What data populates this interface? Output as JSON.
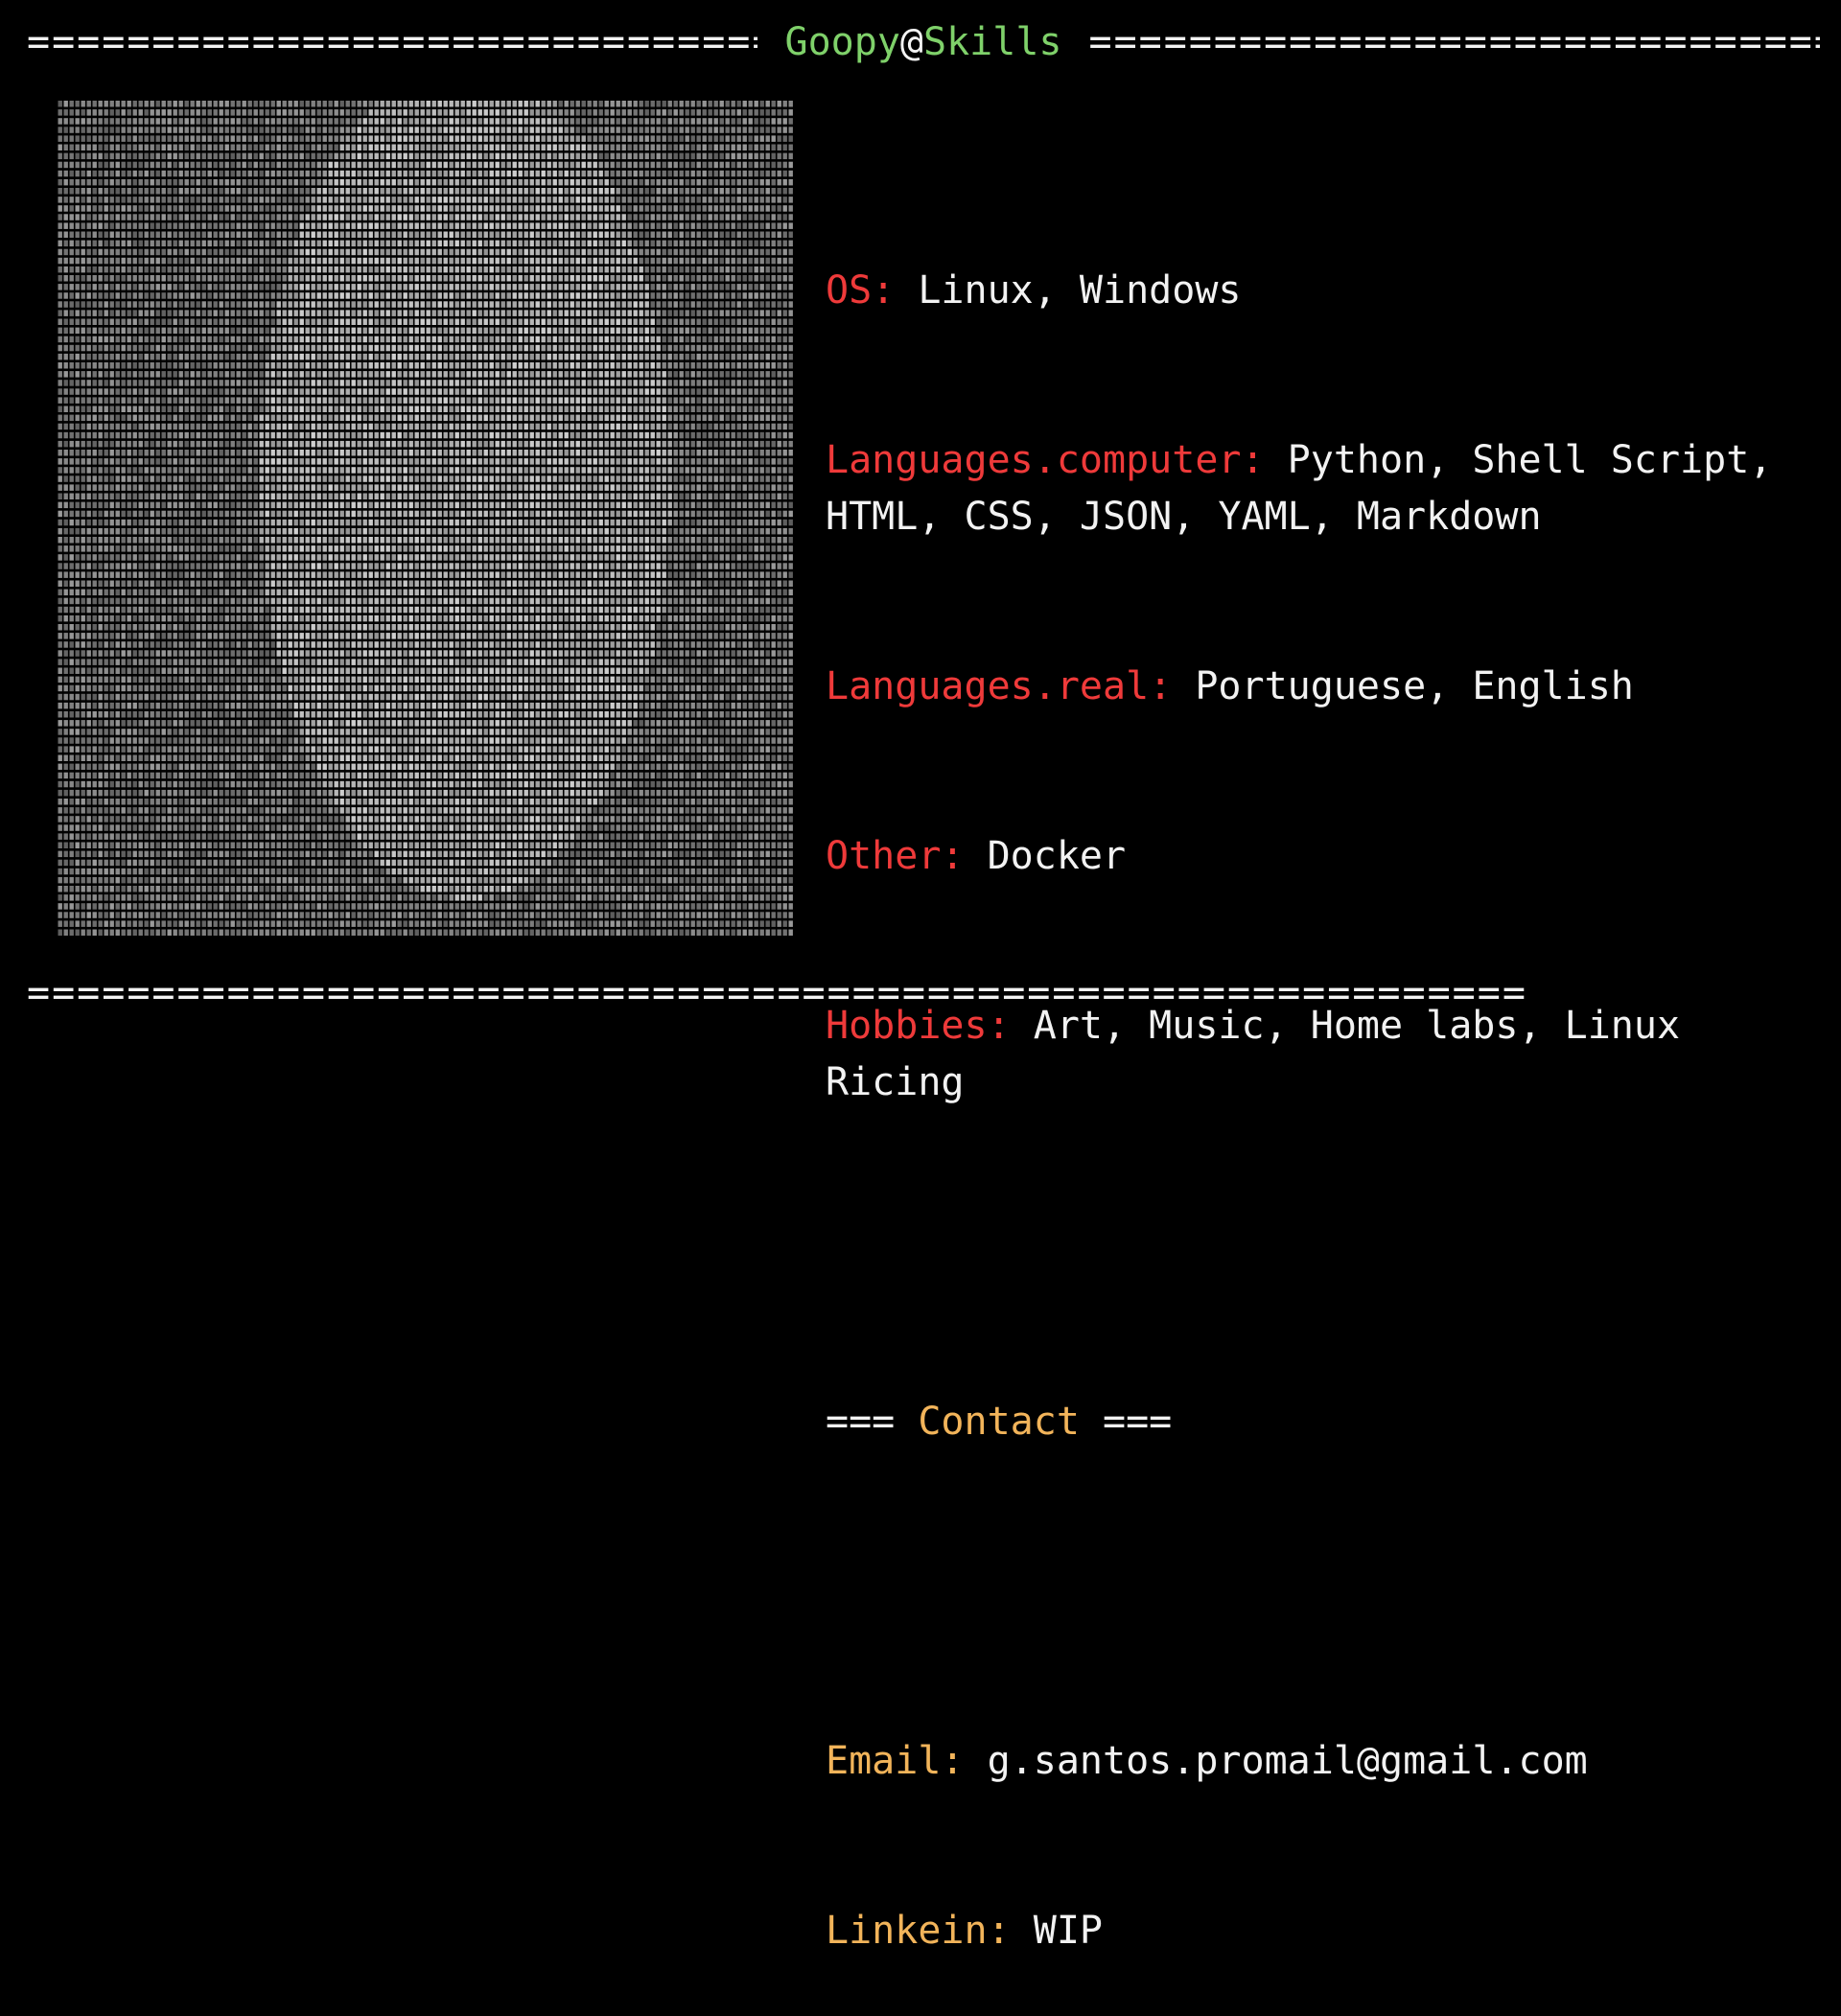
{
  "header": {
    "title_user": "Goopy",
    "title_at": "@",
    "title_host": "Skills",
    "rule_char": "="
  },
  "ascii_art": {
    "description_icon": "ascii-portrait",
    "fg_color": "#cfcfcf",
    "bg_color": "#000000"
  },
  "skills": [
    {
      "key": "OS:",
      "value": "Linux, Windows"
    },
    {
      "key": "Languages.computer:",
      "value": "Python, Shell Script, HTML, CSS, JSON, YAML, Markdown"
    },
    {
      "key": "Languages.real:",
      "value": "Portuguese, English"
    },
    {
      "key": "Other:",
      "value": "Docker"
    },
    {
      "key": "Hobbies:",
      "value": "Art, Music, Home labs, Linux Ricing"
    }
  ],
  "contact": {
    "prefix": "=== ",
    "title": "Contact",
    "suffix": " ===",
    "email_label": "Email:",
    "email_value": "g.santos.promail@gmail.com",
    "linkedin_label": "Linkein:",
    "linkedin_value": "WIP"
  },
  "colors": {
    "background": "#000000",
    "text": "#f2f2f2",
    "title_green": "#7fd16a",
    "key_red": "#ef3a3a",
    "accent_orange": "#f2b45a"
  }
}
